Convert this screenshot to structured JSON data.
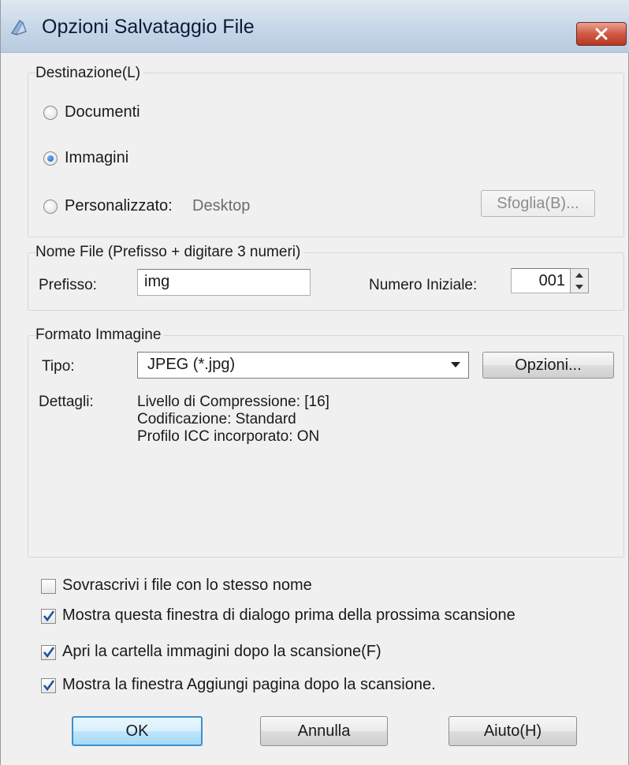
{
  "window": {
    "title": "Opzioni Salvataggio File"
  },
  "destination": {
    "title": "Destinazione(L)",
    "options": [
      {
        "label": "Documenti",
        "selected": false
      },
      {
        "label": "Immagini",
        "selected": true
      },
      {
        "label": "Personalizzato:",
        "selected": false
      }
    ],
    "custom_path": "Desktop",
    "browse_label": "Sfoglia(B)..."
  },
  "file_name": {
    "title": "Nome File (Prefisso + digitare 3 numeri)",
    "prefix_label": "Prefisso:",
    "prefix_value": "img",
    "start_label": "Numero Iniziale:",
    "start_value": "001"
  },
  "image_format": {
    "title": "Formato Immagine",
    "type_label": "Tipo:",
    "type_value": "JPEG (*.jpg)",
    "options_label": "Opzioni...",
    "details_label": "Dettagli:",
    "details": [
      "Livello di Compressione: [16]",
      "Codificazione: Standard",
      "Profilo ICC incorporato: ON"
    ]
  },
  "checkboxes": [
    {
      "label": "Sovrascrivi i file con lo stesso nome",
      "checked": false
    },
    {
      "label": "Mostra questa finestra di dialogo prima della prossima scansione",
      "checked": true
    },
    {
      "label": "Apri la cartella immagini dopo la scansione(F)",
      "checked": true
    },
    {
      "label": "Mostra la finestra Aggiungi pagina dopo la scansione.",
      "checked": true
    }
  ],
  "buttons": {
    "ok": "OK",
    "cancel": "Annulla",
    "help": "Aiuto(H)"
  },
  "colors": {
    "titlebar": "#c6d6e8",
    "close_button": "#cf5a44",
    "default_button_border": "#3c8fd0",
    "checkmark": "#2050a0"
  }
}
